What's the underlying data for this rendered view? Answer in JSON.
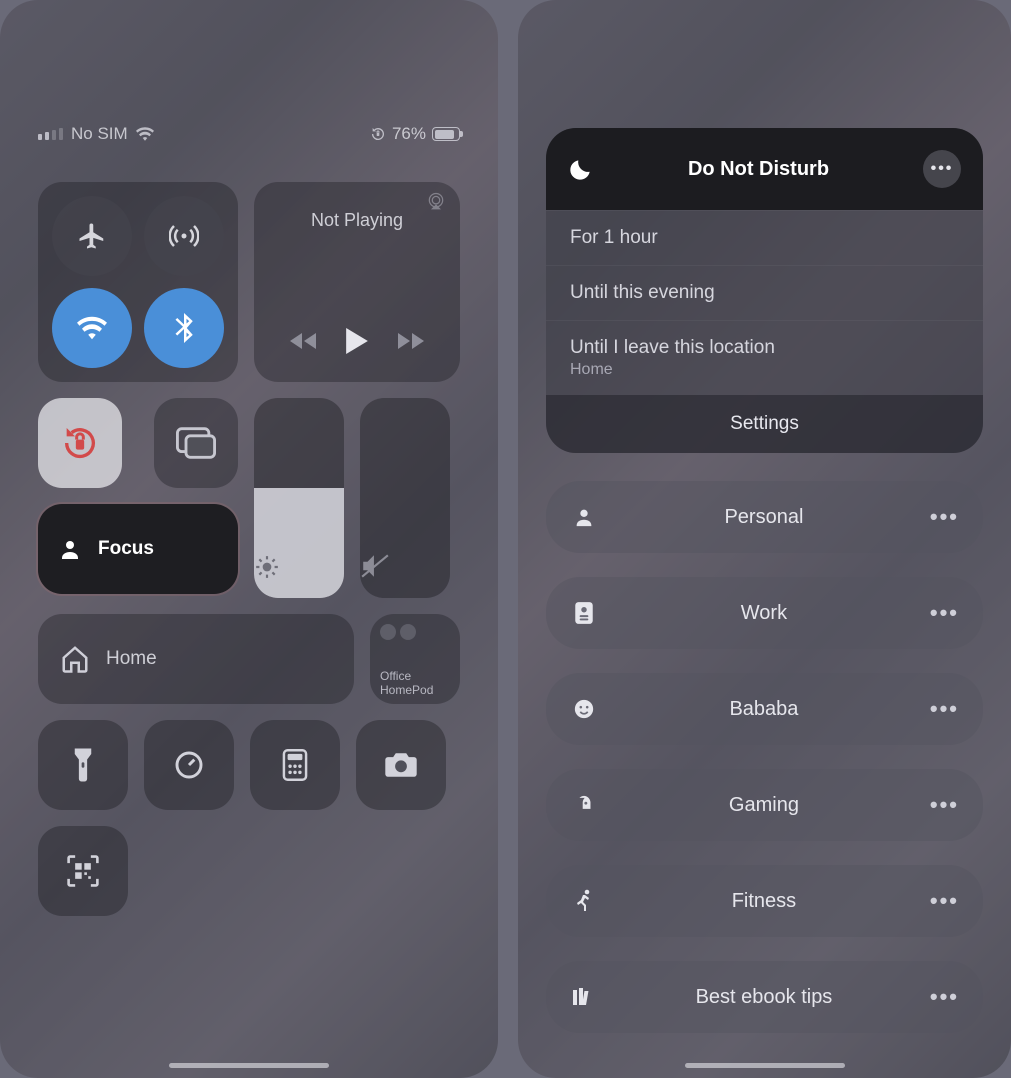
{
  "left": {
    "status": {
      "carrier": "No SIM",
      "battery_percent": "76%"
    },
    "media": {
      "title": "Not Playing"
    },
    "focus": {
      "label": "Focus"
    },
    "home": {
      "label": "Home"
    },
    "homepod": {
      "line1": "Office",
      "line2": "HomePod"
    }
  },
  "right": {
    "dnd": {
      "title": "Do Not Disturb",
      "options": [
        {
          "label": "For 1 hour"
        },
        {
          "label": "Until this evening"
        },
        {
          "label": "Until I leave this location",
          "sub": "Home"
        }
      ],
      "settings": "Settings"
    },
    "focus_modes": [
      {
        "icon": "person",
        "label": "Personal"
      },
      {
        "icon": "badge",
        "label": "Work"
      },
      {
        "icon": "smile",
        "label": "Bababa"
      },
      {
        "icon": "rocket",
        "label": "Gaming"
      },
      {
        "icon": "run",
        "label": "Fitness"
      },
      {
        "icon": "books",
        "label": "Best ebook tips"
      }
    ]
  }
}
